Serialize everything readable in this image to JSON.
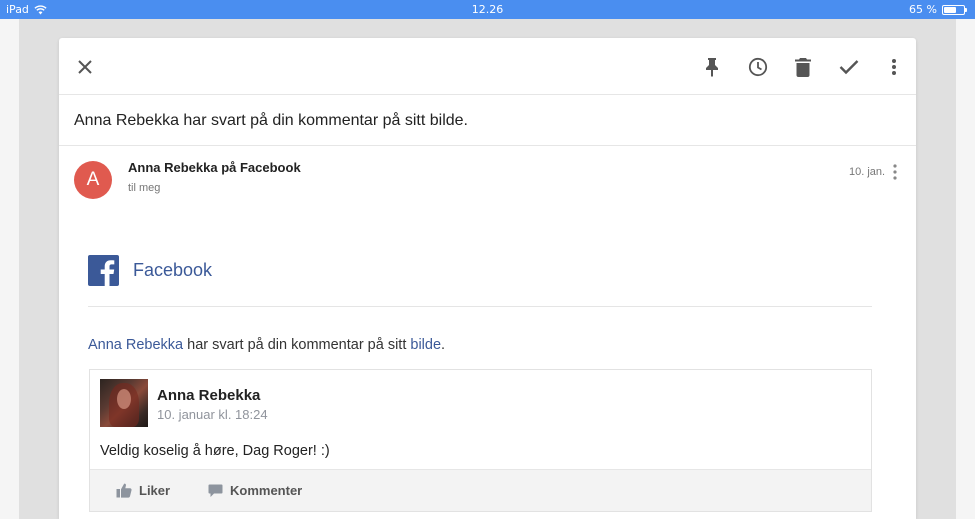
{
  "status_bar": {
    "device": "iPad",
    "time": "12.26",
    "battery": "65 %",
    "battery_level": 0.65
  },
  "toolbar": {
    "icons": [
      "close-icon",
      "pin-icon",
      "snooze-icon",
      "delete-icon",
      "done-icon",
      "more-icon"
    ]
  },
  "email": {
    "subject": "Anna Rebekka har svart på din kommentar på sitt bilde.",
    "avatar_letter": "A",
    "avatar_color": "#e05a4f",
    "sender": "Anna Rebekka på Facebook",
    "recipient": "til meg",
    "date": "10. jan."
  },
  "body": {
    "brand": "Facebook",
    "brand_color": "#3b5998",
    "notification": {
      "name_link": "Anna Rebekka",
      "middle": " har svart på din kommentar på sitt ",
      "photo_link": "bilde",
      "end": "."
    },
    "comment": {
      "author": "Anna Rebekka",
      "timestamp": "10. januar kl. 18:24",
      "text": "Veldig koselig å høre, Dag Roger! :)",
      "like_label": "Liker",
      "comment_label": "Kommenter"
    }
  }
}
